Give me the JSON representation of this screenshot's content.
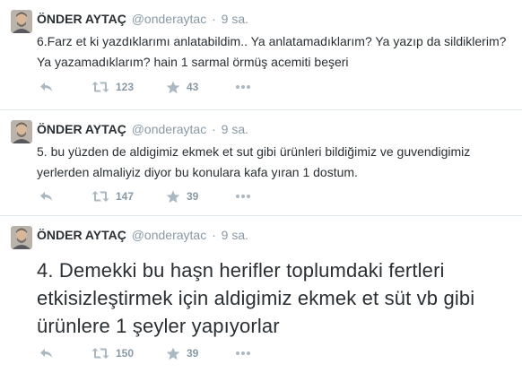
{
  "tweets": [
    {
      "name": "ÖNDER AYTAÇ",
      "handle": "@onderaytac",
      "separator": "·",
      "time": "9 sa.",
      "text": "6.Farz et ki yazdıklarımı anlatabildim.. Ya anlatamadıklarım? Ya yazıp da sildiklerim? Ya yazamadıklarım? hain 1 sarmal örmüş acemiti beşeri",
      "retweets": "123",
      "favorites": "43"
    },
    {
      "name": "ÖNDER AYTAÇ",
      "handle": "@onderaytac",
      "separator": "·",
      "time": "9 sa.",
      "text": "5. bu yüzden de aldigimiz ekmek et sut gibi ürünleri bildiğimiz ve guvendigimiz yerlerden almaliyiz diyor bu konulara kafa yıran 1 dostum.",
      "retweets": "147",
      "favorites": "39"
    },
    {
      "name": "ÖNDER AYTAÇ",
      "handle": "@onderaytac",
      "separator": "·",
      "time": "9 sa.",
      "text": "4. Demekki bu haşn herifler toplumdaki fertleri etkisizleştirmek için aldigimiz ekmek et süt vb gibi ürünlere 1 şeyler yapıyorlar",
      "retweets": "150",
      "favorites": "39"
    }
  ],
  "icons": {
    "reply": "reply-icon",
    "retweet": "retweet-icon",
    "favorite": "star-icon",
    "more": "more-dots-icon"
  },
  "colors": {
    "text": "#292f33",
    "muted": "#8899a6",
    "divider": "#e1e8ed",
    "icon": "#aab8c2"
  }
}
